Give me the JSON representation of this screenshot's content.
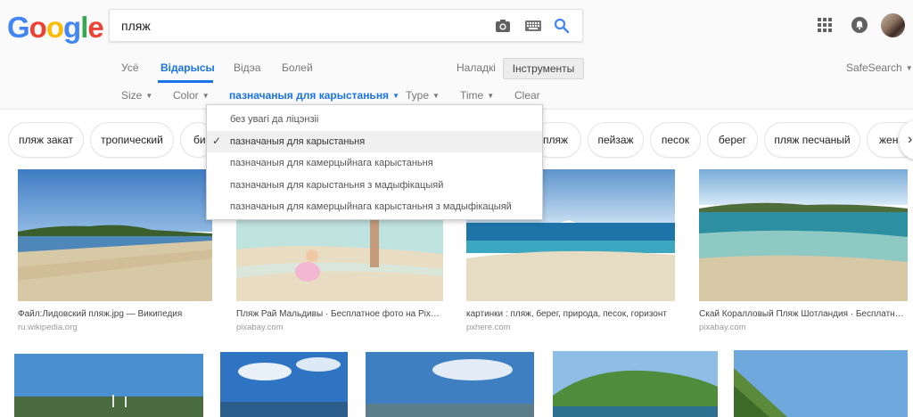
{
  "brand": {
    "logo_letters": [
      "G",
      "o",
      "o",
      "g",
      "l",
      "e"
    ],
    "logo_colors": [
      "#4285F4",
      "#EA4335",
      "#FBBC05",
      "#4285F4",
      "#34A853",
      "#EA4335"
    ]
  },
  "search": {
    "query": "пляж",
    "camera_icon": "camera-icon",
    "keyboard_icon": "keyboard-icon",
    "search_icon": "search-icon"
  },
  "nav": {
    "tabs": [
      {
        "label": "Усё",
        "active": false
      },
      {
        "label": "Відарысы",
        "active": true
      },
      {
        "label": "Відэа",
        "active": false
      },
      {
        "label": "Болей",
        "active": false
      }
    ],
    "settings": "Наладкі",
    "tools": "Інструменты",
    "safesearch": "SafeSearch"
  },
  "tools": {
    "size": "Size",
    "color": "Color",
    "usage": "пазначаныя для карыстаньня",
    "type": "Type",
    "time": "Time",
    "clear": "Clear"
  },
  "dropdown": {
    "items": [
      {
        "label": "без увагі да ліцэнзіі",
        "selected": false
      },
      {
        "label": "пазначаныя для карыстаньня",
        "selected": true
      },
      {
        "label": "пазначаныя для камерцыйнага карыстаньня",
        "selected": false
      },
      {
        "label": "пазначаныя для карыстаньня з мадыфікацыяй",
        "selected": false
      },
      {
        "label": "пазначаныя для камерцыйнага карыстаньня з мадыфікацыяй",
        "selected": false
      }
    ]
  },
  "chips": [
    "пляж закат",
    "тропический",
    "би",
    "пляж",
    "пейзаж",
    "песок",
    "берег",
    "пляж песчаный",
    "женщ"
  ],
  "results": [
    {
      "title": "Файл:Лидовский пляж.jpg — Википедия",
      "source": "ru.wikipedia.org"
    },
    {
      "title": "Пляж Рай Мальдивы · Бесплатное фото на Pixabay",
      "source": "pixabay.com"
    },
    {
      "title": "картинки : пляж, берег, природа, песок, горизонт",
      "source": "pxhere.com"
    },
    {
      "title": "Скай Коралловый Пляж Шотландия · Бесплатное фото",
      "source": "pixabay.com"
    }
  ],
  "colors": {
    "accent": "#1a73e8",
    "muted": "#777777"
  }
}
